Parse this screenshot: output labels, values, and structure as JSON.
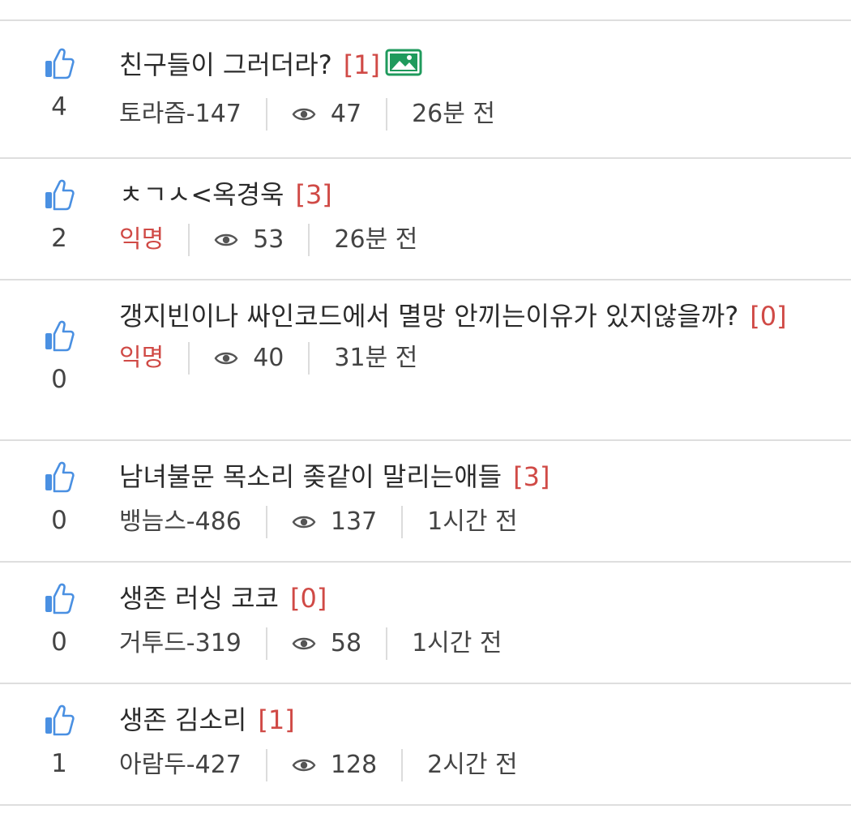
{
  "posts": [
    {
      "likes": "4",
      "title": "친구들이 그러더라?",
      "comments": "[1]",
      "has_image": true,
      "author": "토라즘-147",
      "anonymous": false,
      "views": "47",
      "time": "26분 전"
    },
    {
      "likes": "2",
      "title": "ㅊㄱㅅ<옥경욱",
      "comments": "[3]",
      "has_image": false,
      "author": "익명",
      "anonymous": true,
      "views": "53",
      "time": "26분 전"
    },
    {
      "likes": "0",
      "title": "갱지빈이나 싸인코드에서 멸망 안끼는이유가 있지않을까?",
      "comments": "[0]",
      "has_image": false,
      "author": "익명",
      "anonymous": true,
      "views": "40",
      "time": "31분 전"
    },
    {
      "likes": "0",
      "title": "남녀불문 목소리 좆같이 말리는애들",
      "comments": "[3]",
      "has_image": false,
      "author": "뱅늠스-486",
      "anonymous": false,
      "views": "137",
      "time": "1시간 전"
    },
    {
      "likes": "0",
      "title": "생존 러싱 코코",
      "comments": "[0]",
      "has_image": false,
      "author": "거투드-319",
      "anonymous": false,
      "views": "58",
      "time": "1시간 전"
    },
    {
      "likes": "1",
      "title": "생존 김소리",
      "comments": "[1]",
      "has_image": false,
      "author": "아람두-427",
      "anonymous": false,
      "views": "128",
      "time": "2시간 전"
    }
  ],
  "icons": {
    "like": "thumbs-up-icon",
    "views": "eye-icon",
    "image": "image-icon"
  },
  "colors": {
    "accent_red": "#d04a46",
    "thumb_blue": "#4a90e2",
    "image_green": "#1f9a5c",
    "divider": "#dedede"
  }
}
